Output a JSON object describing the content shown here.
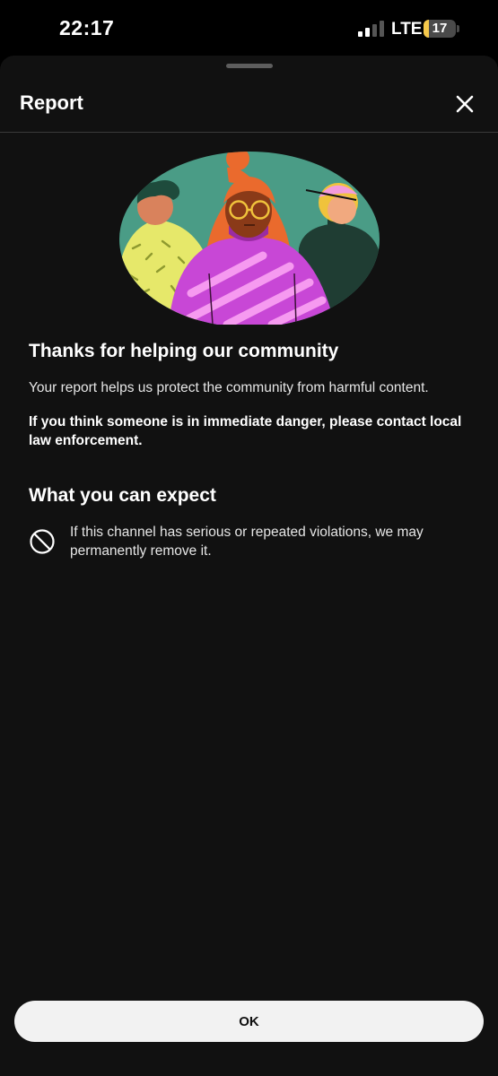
{
  "status_bar": {
    "time": "22:17",
    "network": "LTE",
    "battery_level": "17",
    "battery_fraction": 0.17,
    "icons": [
      "signal-icon",
      "battery-icon"
    ]
  },
  "sheet": {
    "title": "Report",
    "close_icon": "close-icon"
  },
  "content": {
    "heading": "Thanks for helping our community",
    "body": "Your report helps us protect the community from harmful content.",
    "emergency_note": "If you think someone is in immediate danger, please contact local law enforcement.",
    "expect_heading": "What you can expect",
    "expect_items": [
      {
        "icon": "ban-icon",
        "text": "If this channel has serious or repeated violations, we may permanently remove it."
      }
    ]
  },
  "actions": {
    "ok_label": "OK"
  },
  "colors": {
    "sheet_bg": "#111111",
    "illustration_bg": "#4a9c86",
    "button_bg": "#f2f2f2",
    "battery_accent": "#f5c84b"
  }
}
